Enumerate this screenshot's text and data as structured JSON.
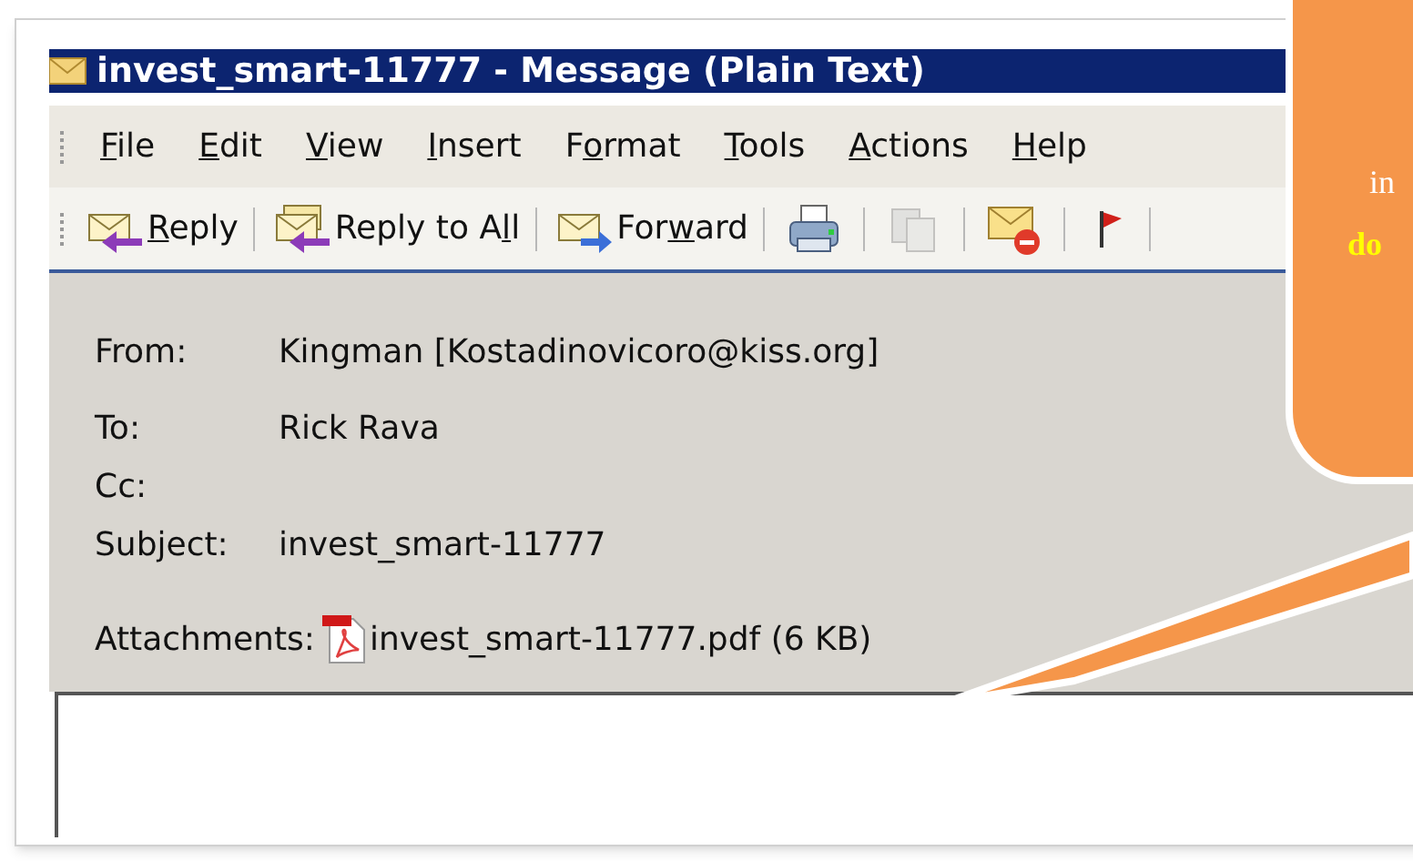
{
  "window": {
    "title": "invest_smart-11777 - Message (Plain Text)"
  },
  "menu": [
    {
      "label": "File"
    },
    {
      "label": "Edit"
    },
    {
      "label": "View"
    },
    {
      "label": "Insert"
    },
    {
      "label": "Format"
    },
    {
      "label": "Tools"
    },
    {
      "label": "Actions"
    },
    {
      "label": "Help"
    }
  ],
  "toolbar": [
    {
      "kind": "button",
      "label": "Reply"
    },
    {
      "kind": "button",
      "label": "Reply to All"
    },
    {
      "kind": "button",
      "label": "Forward"
    },
    {
      "kind": "icon",
      "disabled": false
    },
    {
      "kind": "icon",
      "disabled": true
    },
    {
      "kind": "icon",
      "disabled": false
    },
    {
      "kind": "icon",
      "disabled": false
    }
  ],
  "header": [
    {
      "label": "From:",
      "value": "Kingman [Kostadinovicoro@kiss.org]"
    },
    {
      "label": "To:",
      "value": "Rick Rava"
    },
    {
      "label": "Cc:"
    },
    {
      "label": "Subject:",
      "value": "invest_smart-11777"
    }
  ],
  "attachments": {
    "label": "Attachments:",
    "file": "invest_smart-11777.pdf (6 KB)"
  },
  "callout": {
    "lines": [
      {
        "text": "in",
        "emphasis": false
      },
      {
        "text": "do",
        "emphasis": true
      }
    ]
  }
}
